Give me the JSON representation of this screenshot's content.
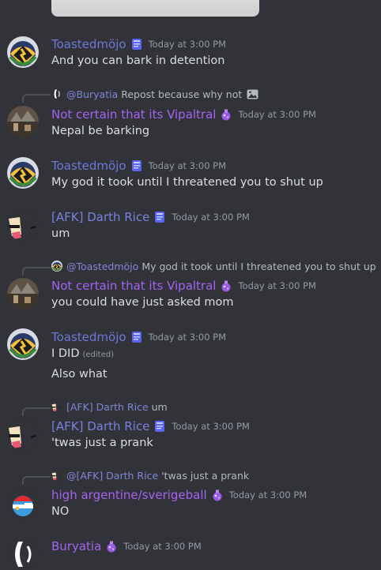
{
  "colors": {
    "background": "#313338",
    "blue_role": "#6f77d9",
    "purple_role": "#a463f2",
    "timestamp": "#949ba4"
  },
  "messages": [
    {
      "author": "Toastedmöjo",
      "timestamp": "Today at 3:00 PM",
      "lines": [
        "And you can bark in detention"
      ],
      "badge": "book-icon"
    },
    {
      "reply": {
        "name": "@Buryatia",
        "text": "Repost because why not"
      },
      "author": "Not certain that its Vipaltral",
      "timestamp": "Today at 3:00 PM",
      "lines": [
        "Nepal be barking"
      ],
      "badge": "potion-icon"
    },
    {
      "author": "Toastedmöjo",
      "timestamp": "Today at 3:00 PM",
      "lines": [
        "My god it took until I threatened you to shut up"
      ],
      "badge": "book-icon"
    },
    {
      "author": "[AFK] Darth Rice",
      "timestamp": "Today at 3:00 PM",
      "lines": [
        "um"
      ],
      "badge": "book-icon"
    },
    {
      "reply": {
        "name": "@Toastedmöjo",
        "text": "My god it took until I threatened you to shut up"
      },
      "author": "Not certain that its Vipaltral",
      "timestamp": "Today at 3:00 PM",
      "lines": [
        "you could have just asked mom"
      ],
      "badge": "potion-icon"
    },
    {
      "author": "Toastedmöjo",
      "timestamp": "Today at 3:00 PM",
      "lines": [
        "I DID",
        "Also what"
      ],
      "edited": "(edited)",
      "badge": "book-icon"
    },
    {
      "reply": {
        "name": "[AFK] Darth Rice",
        "text": "um"
      },
      "author": "[AFK] Darth Rice",
      "timestamp": "Today at 3:00 PM",
      "lines": [
        "'twas just a prank"
      ],
      "badge": "book-icon"
    },
    {
      "reply": {
        "name": "@[AFK] Darth Rice",
        "text": "'twas just a prank"
      },
      "author": "high argentine/sverigeball",
      "timestamp": "Today at 3:00 PM",
      "lines": [
        "NO"
      ],
      "badge": "potion-icon"
    },
    {
      "author": "Buryatia",
      "timestamp": "Today at 3:00 PM",
      "lines": [],
      "badge": "potion-icon"
    }
  ]
}
